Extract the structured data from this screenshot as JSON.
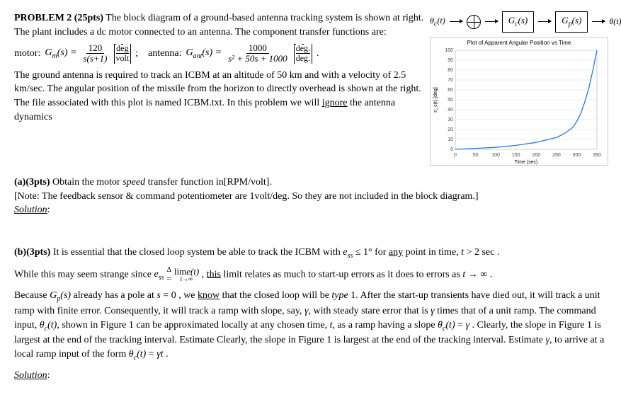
{
  "problem": {
    "header_bold": "PROBLEM 2 (25pts)",
    "header_rest": " The block diagram of a ground-based antenna tracking system is shown at right. The plant includes a dc motor connected to an antenna. The component transfer functions are:",
    "motor_label": "motor:",
    "motor_lhs": "G",
    "motor_sub": "m",
    "motor_sarg": "(s) =",
    "motor_num": "120",
    "motor_den": "s(s+1)",
    "motor_units_num": "deg",
    "motor_units_den": "volt",
    "sep": ";",
    "antenna_label": "antenna:",
    "antenna_lhs": "G",
    "antenna_sub": "ant",
    "antenna_sarg": "(s) =",
    "antenna_num": "1000",
    "antenna_den": "s² + 50s + 1000",
    "antenna_units_num": "deg.",
    "antenna_units_den": "deg.",
    "period": ".",
    "desc1": "The ground antenna is required to track an ICBM at an altitude of 50 km and with a velocity of 2.5 km/sec. The angular position of the missile from the horizon to directly overhead  is shown at the right. The file associated with this plot is named ICBM.txt. In this problem we will ",
    "desc1_under": "ignore",
    "desc1_rest": " the antenna dynamics"
  },
  "diagram": {
    "input": "θ",
    "input_sub": "c",
    "input_arg": "(t)",
    "gc": "G",
    "gc_sub": "c",
    "gc_arg": "(s)",
    "gp": "G",
    "gp_sub": "p",
    "gp_arg": "(s)",
    "output": "θ(t)"
  },
  "chart_data": {
    "type": "line",
    "title": "Plot of Apparent Angular Position vs Time",
    "xlabel": "Time (sec)",
    "ylabel": "η_c(t) [deg]",
    "xlim": [
      0,
      350
    ],
    "ylim": [
      0,
      100
    ],
    "x_ticks": [
      0,
      50,
      100,
      150,
      200,
      250,
      300,
      350
    ],
    "y_ticks": [
      0,
      10,
      20,
      30,
      40,
      50,
      60,
      70,
      80,
      90,
      100
    ],
    "x": [
      0,
      50,
      100,
      150,
      200,
      250,
      270,
      290,
      300,
      310,
      320,
      330,
      340,
      345,
      350
    ],
    "y": [
      0,
      1,
      2,
      4,
      7,
      12,
      16,
      22,
      28,
      36,
      48,
      62,
      80,
      90,
      100
    ]
  },
  "part_a": {
    "label": "(a)(3pts)",
    "text": " Obtain the motor ",
    "speed": "speed",
    "text2": " transfer function in[RPM/volt].",
    "note": "[Note: The feedback sensor & command potentiometer are 1volt/deg. So they are not included in the block diagram.]",
    "solution": "Solution",
    "colon": ":"
  },
  "part_b": {
    "label": "(b)(3pts)",
    "p1a": " It is essential that the closed loop system be able to track the ICBM with  ",
    "e": "e",
    "ess_sub": "ss",
    "p1b": " ≤ 1° for ",
    "any": "any",
    "p1c": " point in time, ",
    "t": "t",
    "p1d": " > 2 sec .",
    "p2a": "While this may seem strange since ",
    "def_over": "Δ",
    "def_eq": "=",
    "lime": "lim",
    "lime_sub": "t→∞",
    "lime_arg": "e(t)",
    "p2b": " , ",
    "this": "this",
    "p2c": " limit relates as much to start-up errors as it does to errors as ",
    "p2d": " → ∞ .",
    "p3a": "Because ",
    "gp": "G",
    "gp_sub": "p",
    "gp_arg": "(s)",
    "p3b": " already has a pole at ",
    "s": "s",
    "p3c": " = 0 , we ",
    "know": "know",
    "p3d": " that the closed loop will be ",
    "type1": "type",
    "p3e": " 1. After the start-up transients have died out, it will track a unit ramp with finite error. Consequently, it will track a ramp with slope, say, ",
    "gamma": "γ",
    "p3f": ", with steady stare error that is ",
    "p3g": " times that of a unit ramp. The command input, ",
    "theta": "θ",
    "theta_sub": "c",
    "theta_arg": "(t)",
    "p3h": ", shown in Figure 1 can be approximated locally at any chosen time, ",
    "p3i": ", as a ramp having a slope ",
    "dot_over": ".",
    "p3j": " = ",
    "p3k": " . Clearly, the slope in Figure 1 is largest at the end of the tracking interval. Estimate ",
    "p3l": ", to arrive at a local ramp input of the form ",
    "p3m": " = ",
    "gammat": "γt",
    "p3n": " .",
    "solution": "Solution",
    "colon": ":"
  }
}
